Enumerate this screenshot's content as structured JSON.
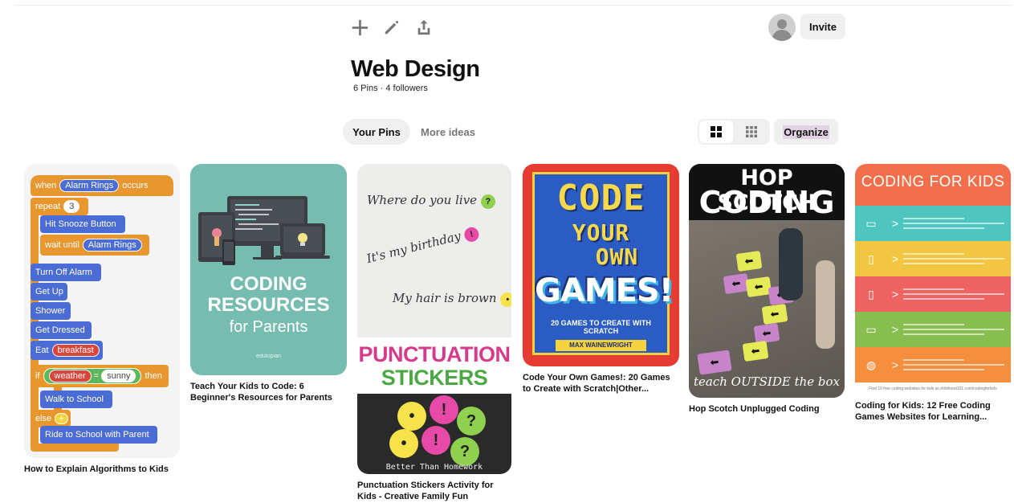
{
  "toolbar": {
    "add_icon": "plus-icon",
    "edit_icon": "pencil-icon",
    "share_icon": "share-icon",
    "invite_label": "Invite"
  },
  "board": {
    "title": "Web Design",
    "meta": "6 Pins · 4 followers"
  },
  "tabs": [
    {
      "label": "Your Pins",
      "active": true
    },
    {
      "label": "More ideas",
      "active": false
    }
  ],
  "view": {
    "options": [
      "grid-large-icon",
      "grid-compact-icon"
    ],
    "active": 0,
    "organize_label": "Organize"
  },
  "pins": [
    {
      "title": "How to Explain Algorithms to Kids",
      "blocks": {
        "when": "when",
        "alarm_rings": "Alarm Rings",
        "occurs": "occurs",
        "repeat": "repeat",
        "repeat_count": "3",
        "hit_snooze": "Hit Snooze Button",
        "wait_until": "wait until",
        "alarm_rings_2": "Alarm Rings",
        "turn_off": "Turn Off Alarm",
        "get_up": "Get Up",
        "shower": "Shower",
        "get_dressed": "Get Dressed",
        "eat": "Eat",
        "breakfast": "breakfast",
        "if": "if",
        "weather": "weather",
        "eq": "=",
        "sunny": "sunny",
        "then": "then",
        "walk": "Walk to School",
        "else": "else",
        "plus": "+",
        "ride": "Ride to School with Parent"
      }
    },
    {
      "title": "Teach Your Kids to Code: 6 Beginner's Resources for Parents",
      "heading1": "CODING",
      "heading2": "RESOURCES",
      "subheading": "for Parents",
      "tag": "edutopian",
      "accent": "#77bcb0"
    },
    {
      "title": "Punctuation Stickers Activity for Kids - Creative Family Fun",
      "line1": "Where do you live",
      "line2": "It's my birthday",
      "line3": "My hair is brown",
      "heading1": "PUNCTUATION",
      "heading2": "STICKERS",
      "tag": "Better Than Homework",
      "q": "?",
      "ex": "!",
      "period": "•"
    },
    {
      "title": "Code Your Own Games!: 20 Games to Create with Scratch|Other...",
      "word1": "CODE",
      "word2": "YOUR",
      "word3": "OWN",
      "word4": "GAMES!",
      "sub": "20 GAMES TO CREATE WITH SCRATCH",
      "author": "MAX WAINEWRIGHT"
    },
    {
      "title": "Hop Scotch Unplugged Coding",
      "heading1": "HOP SCOTCH",
      "heading2": "CODING",
      "footer": "teach OUTSIDE the box",
      "arrow": "⬅"
    },
    {
      "title": "Coding for Kids: 12 Free Coding Games Websites for Learning...",
      "heading": "CODING FOR KIDS",
      "arrow": ">",
      "footer": "Find 10 free coding websites for kids at childhood101.com/codingforkids",
      "bands": [
        {
          "color": "#4ec6bf",
          "icon": "laptop-icon"
        },
        {
          "color": "#f2c640",
          "icon": "document-icon"
        },
        {
          "color": "#ef6460",
          "icon": "phone-icon"
        },
        {
          "color": "#88bd4f",
          "icon": "monitor-icon"
        },
        {
          "color": "#f58f3e",
          "icon": "brain-icon"
        }
      ]
    }
  ]
}
